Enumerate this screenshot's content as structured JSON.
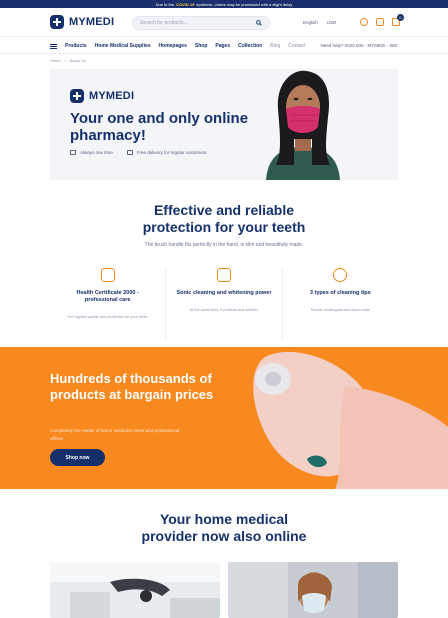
{
  "topbar": {
    "pre": "Due to the",
    "highlight": "COVID 19",
    "post": "epidemic, orders may be processed with a slight delay"
  },
  "header": {
    "brand": "MYMEDI",
    "search_placeholder": "Search for products...",
    "language": "English",
    "currency": "USD",
    "cart_count": "0"
  },
  "nav": {
    "items": [
      "Products",
      "Home Medical Supplies",
      "Homepages",
      "Shop",
      "Pages",
      "Collection"
    ],
    "muted_items": [
      "Blog",
      "Contact"
    ],
    "help": "Need help? 0020 500 - MYMEDI - 000"
  },
  "breadcrumb": [
    "Home",
    "/",
    "About Us"
  ],
  "hero": {
    "brand": "MYMEDI",
    "title": "Your one and only online pharmacy!",
    "features": [
      "Always one time",
      "Free delivery for regular customers"
    ]
  },
  "protection": {
    "title": "Effective and reliable protection for your teeth",
    "subtitle": "The brush handle fits perfectly in the hand, is slim and beautifully made.",
    "columns": [
      {
        "title": "Health Certificate 2000 - professional care",
        "text": "The highest quality and protection for your teeth."
      },
      {
        "title": "Sonic cleaning and whitening power",
        "text": "At the same time, it protects and whitens"
      },
      {
        "title": "3 types of cleaning tips",
        "text": "Round, rectangular and super-wide"
      }
    ]
  },
  "promo": {
    "title": "Hundreds of thousands of products at bargain prices",
    "text": "Completely the needs of home medicine chest and professional offices",
    "button": "Shop now"
  },
  "provider": {
    "title": "Your home medical provider now also online"
  },
  "colors": {
    "navy": "#16306b",
    "orange": "#f7891f",
    "accent": "#f08a24",
    "hero_bg": "#f3f5f9"
  }
}
